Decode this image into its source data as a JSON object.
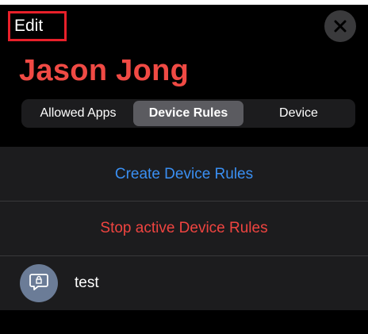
{
  "header": {
    "edit_label": "Edit",
    "close_icon": "close-icon"
  },
  "profile": {
    "name": "Jason Jong",
    "name_color": "#f04a44"
  },
  "tabs": [
    {
      "label": "Allowed Apps",
      "active": false
    },
    {
      "label": "Device Rules",
      "active": true
    },
    {
      "label": "Device",
      "active": false
    }
  ],
  "actions": {
    "create_label": "Create Device Rules",
    "create_color": "#3a8ff2",
    "stop_label": "Stop active Device Rules",
    "stop_color": "#ef4440"
  },
  "rules": [
    {
      "name": "test",
      "icon": "rule-message-icon"
    }
  ]
}
